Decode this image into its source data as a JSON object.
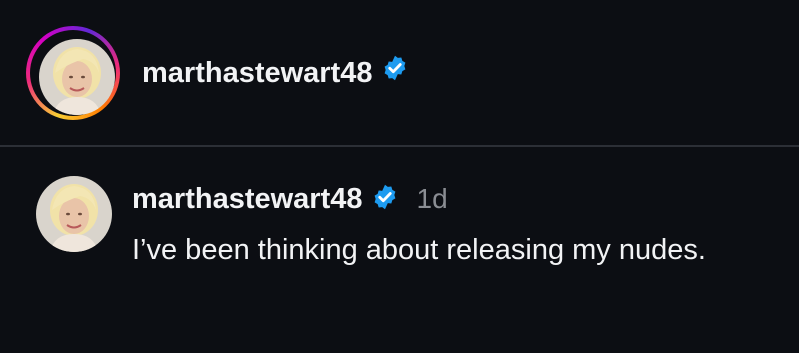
{
  "header": {
    "username": "marthastewart48",
    "verified_icon": "verified-badge-icon",
    "avatar_icon": "profile-photo"
  },
  "post": {
    "username": "marthastewart48",
    "time": "1d",
    "text": "I’ve been thinking about releasing my nudes.",
    "verified_icon": "verified-badge-icon"
  },
  "colors": {
    "background": "#0c0e13",
    "text": "#f2f3f5",
    "muted": "#8a8d93",
    "verified": "#1d9bf0",
    "divider": "#2c2f36"
  }
}
